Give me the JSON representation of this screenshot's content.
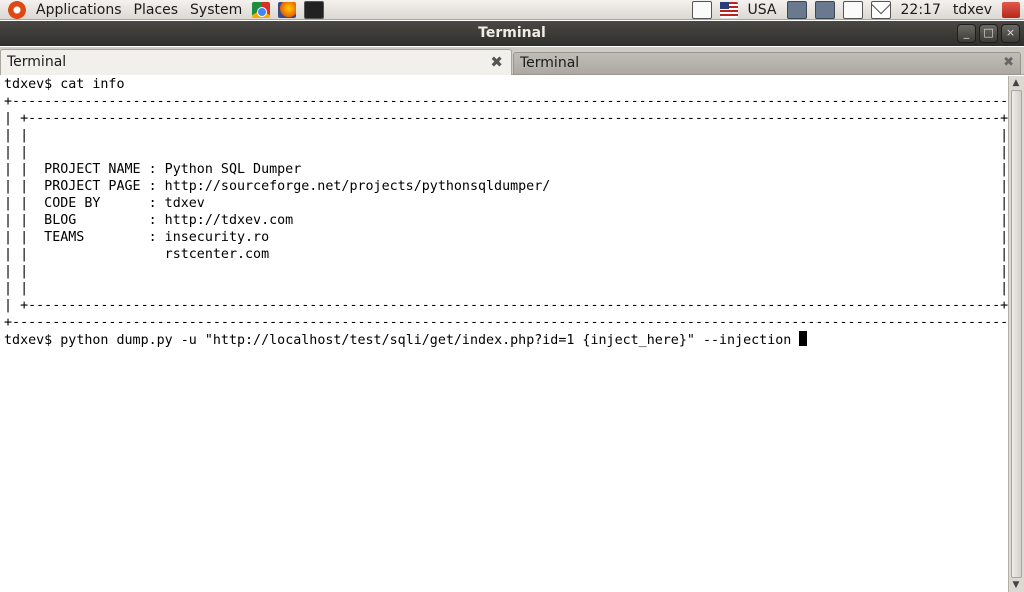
{
  "panel": {
    "menus": [
      "Applications",
      "Places",
      "System"
    ],
    "keyboard_layout": "USA",
    "clock": "22:17",
    "user": "tdxev"
  },
  "window": {
    "title": "Terminal",
    "buttons": [
      "_",
      "□",
      "×"
    ]
  },
  "tabs": [
    {
      "label": "Terminal",
      "active": true,
      "close": "✖"
    },
    {
      "label": "Terminal",
      "active": false,
      "close": "✖"
    }
  ],
  "terminal": {
    "lines": [
      "tdxev$ cat info",
      "+-----------------------------------------------------------------------------------------------------------------------------+",
      "| +-------------------------------------------------------------------------------------------------------------------------+ |",
      "| |                                                                                                                         | |",
      "| |                                                                                                                         | |",
      "| |  PROJECT NAME : Python SQL Dumper                                                                                       | |",
      "| |  PROJECT PAGE : http://sourceforge.net/projects/pythonsqldumper/                                                        | |",
      "| |  CODE BY      : tdxev                                                                                                   | |",
      "| |  BLOG         : http://tdxev.com                                                                                        | |",
      "| |  TEAMS        : insecurity.ro                                                                                           | |",
      "| |                 rstcenter.com                                                                                           | |",
      "| |                                                                                                                         | |",
      "| |                                                                                                                         | |",
      "| +-------------------------------------------------------------------------------------------------------------------------+ |",
      "+-----------------------------------------------------------------------------------------------------------------------------+"
    ],
    "prompt": "tdxev$ ",
    "current_command": "python dump.py -u \"http://localhost/test/sqli/get/index.php?id=1 {inject_here}\" --injection "
  },
  "icons": {
    "panel": [
      "ubuntu-logo-icon",
      "chrome-icon",
      "firefox-icon",
      "terminal-launcher-icon",
      "window-list-icon",
      "flag-icon",
      "network-icon",
      "display-icon",
      "volume-icon",
      "mail-icon",
      "power-icon"
    ]
  }
}
